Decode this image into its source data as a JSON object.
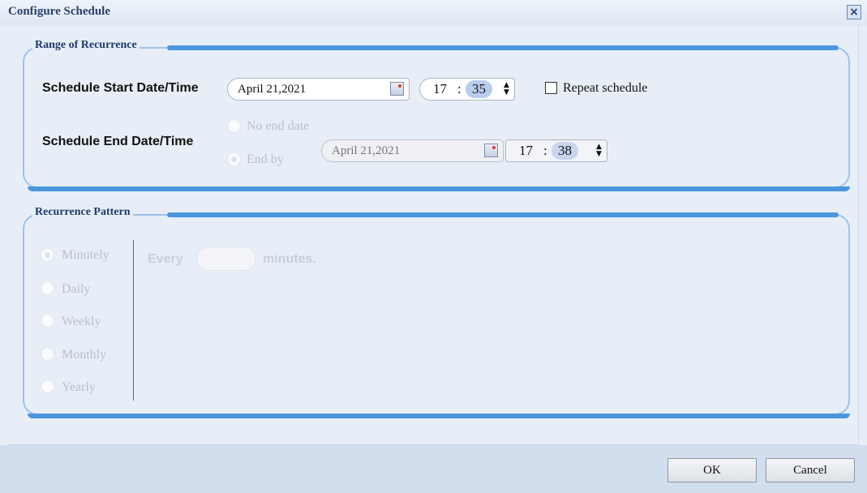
{
  "dialog": {
    "title": "Configure Schedule",
    "close_glyph": "×"
  },
  "range_group": {
    "legend": "Range of Recurrence",
    "start_label": "Schedule Start Date/Time",
    "start_date": "April 21,2021",
    "start_hour": "17",
    "start_minute": "35",
    "time_separator": ":",
    "repeat_label": "Repeat schedule",
    "repeat_checked": false,
    "end_label": "Schedule End Date/Time",
    "no_end_label": "No end date",
    "end_by_label": "End by",
    "end_date": "April 21,2021",
    "end_hour": "17",
    "end_minute": "38"
  },
  "pattern_group": {
    "legend": "Recurrence Pattern",
    "options": [
      "Minutely",
      "Daily",
      "Weekly",
      "Monthly",
      "Yearly"
    ],
    "selected": "Minutely",
    "every_label": "Every",
    "every_value": "",
    "unit_label": "minutes."
  },
  "footer": {
    "ok_label": "OK",
    "cancel_label": "Cancel"
  },
  "icons": {
    "calendar": "calendar-icon",
    "spinner": "spinner-icon",
    "close": "close-icon"
  },
  "colors": {
    "accent": "#4a96de",
    "title": "#2b3f6b",
    "minute_highlight": "#b9ccf0"
  }
}
